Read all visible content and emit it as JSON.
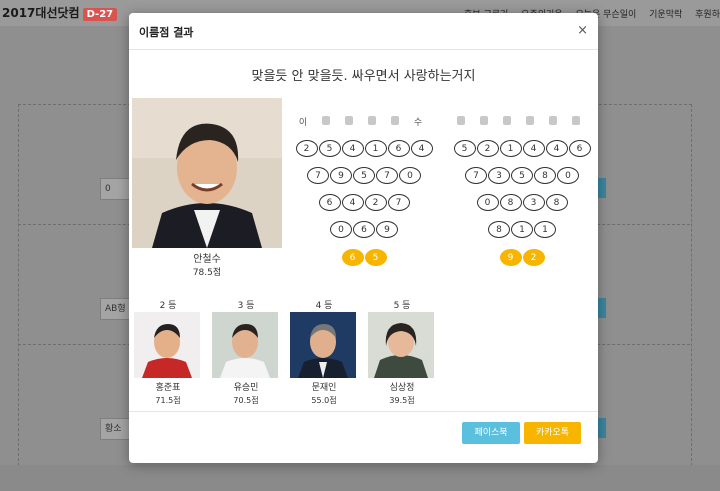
{
  "background": {
    "brand": "2017대선닷컴",
    "dday": "D-27",
    "nav": [
      "후보 고르기",
      "오주의기운",
      "오늘은 무슨일이",
      "기운막락",
      "후원하"
    ],
    "fields": [
      "0",
      "AB형",
      "황소"
    ]
  },
  "modal": {
    "title": "이름점 결과",
    "close": "×",
    "tagline": "맞을듯 안 맞을듯. 싸우면서 사랑하는거지",
    "winner": {
      "name": "안철수",
      "score": "78.5점"
    },
    "name_points": {
      "left_letters": [
        "이",
        "",
        "",
        "",
        "",
        "수"
      ],
      "right_letters": [
        "",
        "",
        "",
        "",
        "",
        ""
      ],
      "left": [
        [
          2,
          5,
          4,
          1,
          6,
          4
        ],
        [
          7,
          9,
          5,
          7,
          0
        ],
        [
          6,
          4,
          2,
          7
        ],
        [
          0,
          6,
          9
        ],
        [
          6,
          5
        ]
      ],
      "right": [
        [
          5,
          2,
          1,
          4,
          4,
          6
        ],
        [
          7,
          3,
          5,
          8,
          0
        ],
        [
          0,
          8,
          3,
          8
        ],
        [
          8,
          1,
          1
        ],
        [
          9,
          2
        ]
      ]
    },
    "runners": [
      {
        "rank": "2 등",
        "name": "홍준표",
        "score": "71.5점"
      },
      {
        "rank": "3 등",
        "name": "유승민",
        "score": "70.5점"
      },
      {
        "rank": "4 등",
        "name": "문재인",
        "score": "55.0점"
      },
      {
        "rank": "5 등",
        "name": "심상정",
        "score": "39.5점"
      }
    ],
    "buttons": {
      "facebook": "페이스북",
      "kakao": "카카오톡"
    }
  },
  "colors": {
    "final_circle": "#f7b500",
    "facebook": "#5bc0de",
    "kakao": "#f7b500",
    "dday": "#d9534f"
  }
}
